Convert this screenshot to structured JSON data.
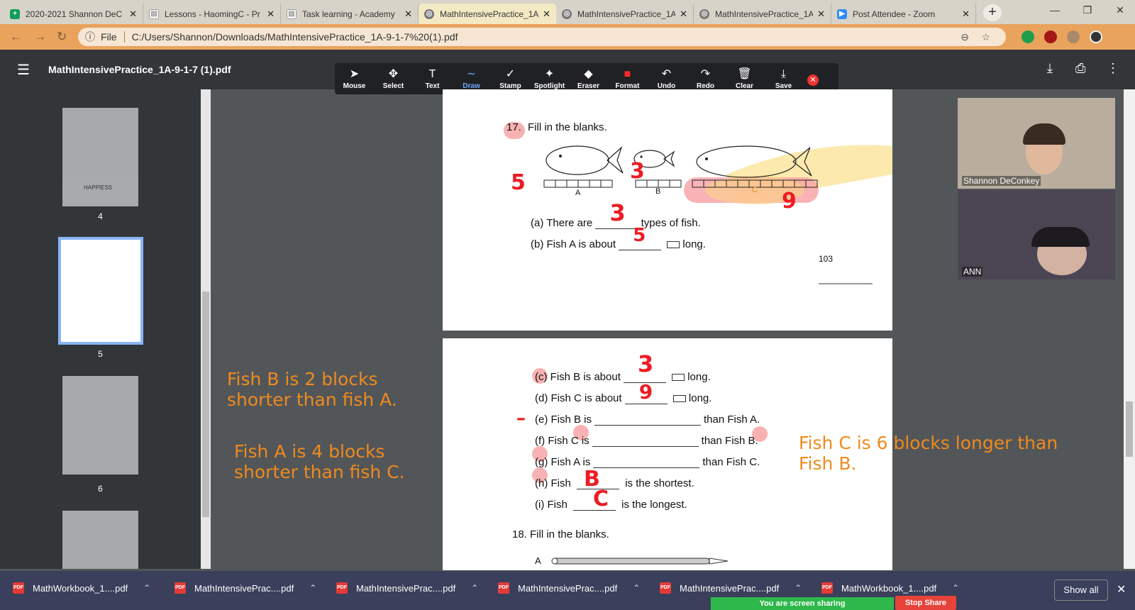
{
  "tabs": [
    {
      "title": "2020-2021 Shannon DeC",
      "icon": "sheets-icon",
      "color": "#0f9d58"
    },
    {
      "title": "Lessons - HaomingC - Pr",
      "icon": "page-icon",
      "color": "#fff"
    },
    {
      "title": "Task learning - Academy",
      "icon": "page-icon",
      "color": "#fff"
    },
    {
      "title": "MathIntensivePractice_1A",
      "icon": "globe-icon",
      "color": "#666"
    },
    {
      "title": "MathIntensivePractice_1A",
      "icon": "globe-icon",
      "color": "#666"
    },
    {
      "title": "MathIntensivePractice_1A",
      "icon": "globe-icon",
      "color": "#666"
    },
    {
      "title": "Post Attendee - Zoom",
      "icon": "zoom-icon",
      "color": "#2d8cff"
    }
  ],
  "address": {
    "scheme": "File",
    "url": "C:/Users/Shannon/Downloads/MathIntensivePractice_1A-9-1-7%20(1).pdf"
  },
  "pdf": {
    "title": "MathIntensivePractice_1A-9-1-7 (1).pdf"
  },
  "annotation_tools": [
    {
      "label": "Mouse",
      "icon": "cursor-icon",
      "glyph": "➤"
    },
    {
      "label": "Select",
      "icon": "move-icon",
      "glyph": "✥"
    },
    {
      "label": "Text",
      "icon": "text-icon",
      "glyph": "T"
    },
    {
      "label": "Draw",
      "icon": "draw-icon",
      "glyph": "∼"
    },
    {
      "label": "Stamp",
      "icon": "check-icon",
      "glyph": "✓"
    },
    {
      "label": "Spotlight",
      "icon": "spotlight-icon",
      "glyph": "✦"
    },
    {
      "label": "Eraser",
      "icon": "eraser-icon",
      "glyph": "◆"
    },
    {
      "label": "Format",
      "icon": "format-icon",
      "glyph": "■"
    },
    {
      "label": "Undo",
      "icon": "undo-icon",
      "glyph": "↶"
    },
    {
      "label": "Redo",
      "icon": "redo-icon",
      "glyph": "↷"
    },
    {
      "label": "Clear",
      "icon": "trash-icon",
      "glyph": "🗑"
    },
    {
      "label": "Save",
      "icon": "save-icon",
      "glyph": "⤓"
    }
  ],
  "thumbnails": [
    {
      "num": "4"
    },
    {
      "num": "5"
    },
    {
      "num": "6"
    }
  ],
  "thumb4_text": "HAPPIESS",
  "page1": {
    "q17_num": "17.",
    "q17_title": "Fill in the blanks.",
    "label_a": "A",
    "label_b": "B",
    "label_c": "C",
    "line_a_pre": "(a)  There are",
    "line_a_post": "types of fish.",
    "line_b_pre": "(b)  Fish A is about",
    "line_b_post": "long.",
    "page_num": "103",
    "hw": {
      "n5": "5",
      "n3": "3",
      "n9": "9",
      "a3": "3",
      "b5": "5"
    }
  },
  "page2": {
    "c_pre": "(c)  Fish B is about",
    "c_post": "long.",
    "d_pre": "(d)  Fish C is about",
    "d_post": "long.",
    "e_pre": "(e)  Fish B is",
    "e_post": "than Fish A.",
    "f_pre": "(f)  Fish C is",
    "f_post": "than Fish B.",
    "g_pre": "(g)  Fish A is",
    "g_post": "than Fish C.",
    "h_pre": "(h)  Fish",
    "h_post": "is the shortest.",
    "i_pre": "(i)  Fish",
    "i_post": "is the longest.",
    "q18": "18.  Fill in the blanks.",
    "row_a": "A",
    "hw": {
      "c": "3",
      "d": "9",
      "dash": "–",
      "h": "B",
      "i": "C"
    }
  },
  "notes": [
    {
      "text": "Fish B is 2 blocks shorter than fish A."
    },
    {
      "text": "Fish A is 4 blocks shorter than fish C."
    },
    {
      "text": "Fish C is 6 blocks longer than Fish B."
    }
  ],
  "participants": [
    {
      "name": "Shannon DeConkey"
    },
    {
      "name": "ANN"
    }
  ],
  "downloads": [
    {
      "name": "MathWorkbook_1....pdf"
    },
    {
      "name": "MathIntensivePrac....pdf"
    },
    {
      "name": "MathIntensivePrac....pdf"
    },
    {
      "name": "MathIntensivePrac....pdf"
    },
    {
      "name": "MathIntensivePrac....pdf"
    },
    {
      "name": "MathWorkbook_1....pdf"
    }
  ],
  "show_all": "Show all",
  "screen_share": {
    "status": "You are screen sharing",
    "stop": "Stop Share"
  }
}
